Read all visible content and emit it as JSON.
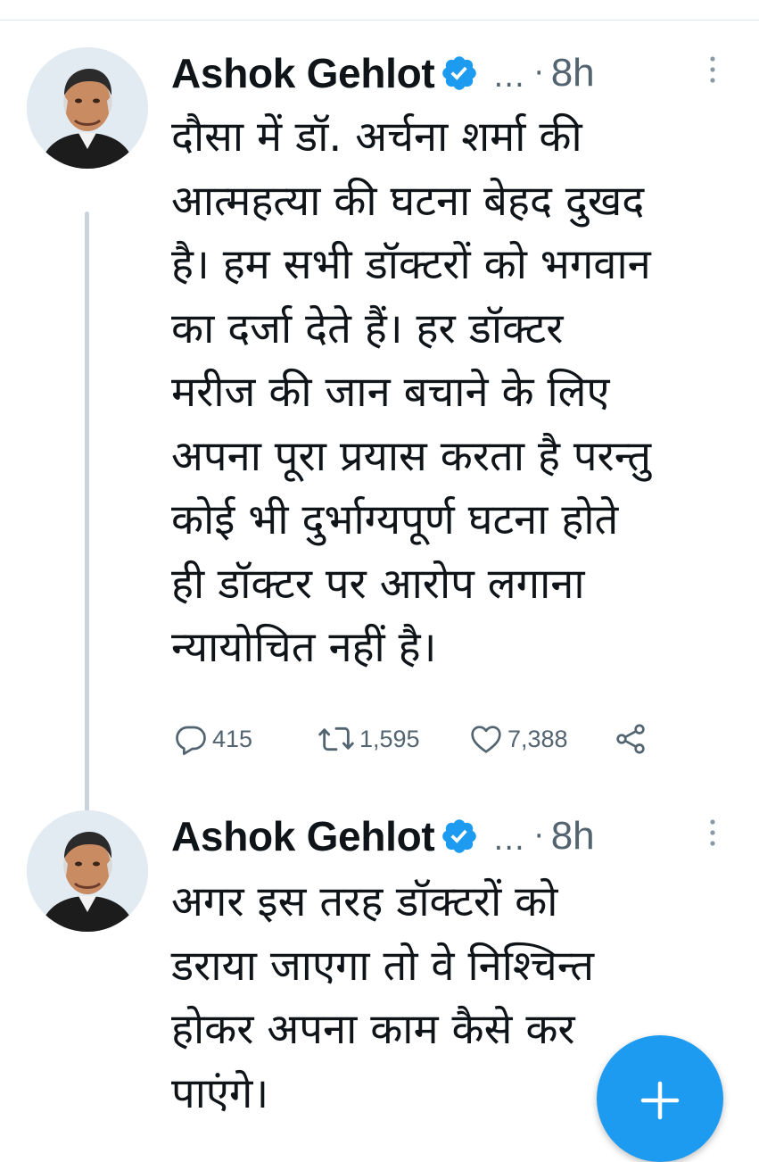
{
  "colors": {
    "accent": "#1d9bf0",
    "secondary_text": "#536471",
    "thread_line": "#c9d3dc"
  },
  "tweets": [
    {
      "author": "Ashok Gehlot",
      "handle_truncated": "...",
      "separator": "·",
      "time": "8h",
      "verified": true,
      "text": "दौसा में डॉ. अर्चना शर्मा की\nआत्महत्या की घटना बेहद दुखद\nहै। हम सभी डॉक्टरों को भगवान\nका दर्जा देते हैं। हर डॉक्टर\nमरीज की जान बचाने के लिए\nअपना पूरा प्रयास करता है परन्तु\nकोई भी दुर्भाग्यपूर्ण घटना होते\nही डॉक्टर पर आरोप लगाना\nन्यायोचित नहीं है।",
      "replies": "415",
      "retweets": "1,595",
      "likes": "7,388"
    },
    {
      "author": "Ashok Gehlot",
      "handle_truncated": "...",
      "separator": "·",
      "time": "8h",
      "verified": true,
      "text": "अगर इस तरह डॉक्टरों को\nडराया जाएगा तो वे निश्चिन्त\nहोकर अपना काम कैसे कर\nपाएंगे।"
    }
  ],
  "icons": {
    "reply": "comment-bubble-icon",
    "retweet": "retweet-arrows-icon",
    "like": "heart-icon",
    "share": "share-icon",
    "verified": "verified-badge-icon",
    "more": "vertical-ellipsis-icon",
    "compose": "plus-icon"
  }
}
